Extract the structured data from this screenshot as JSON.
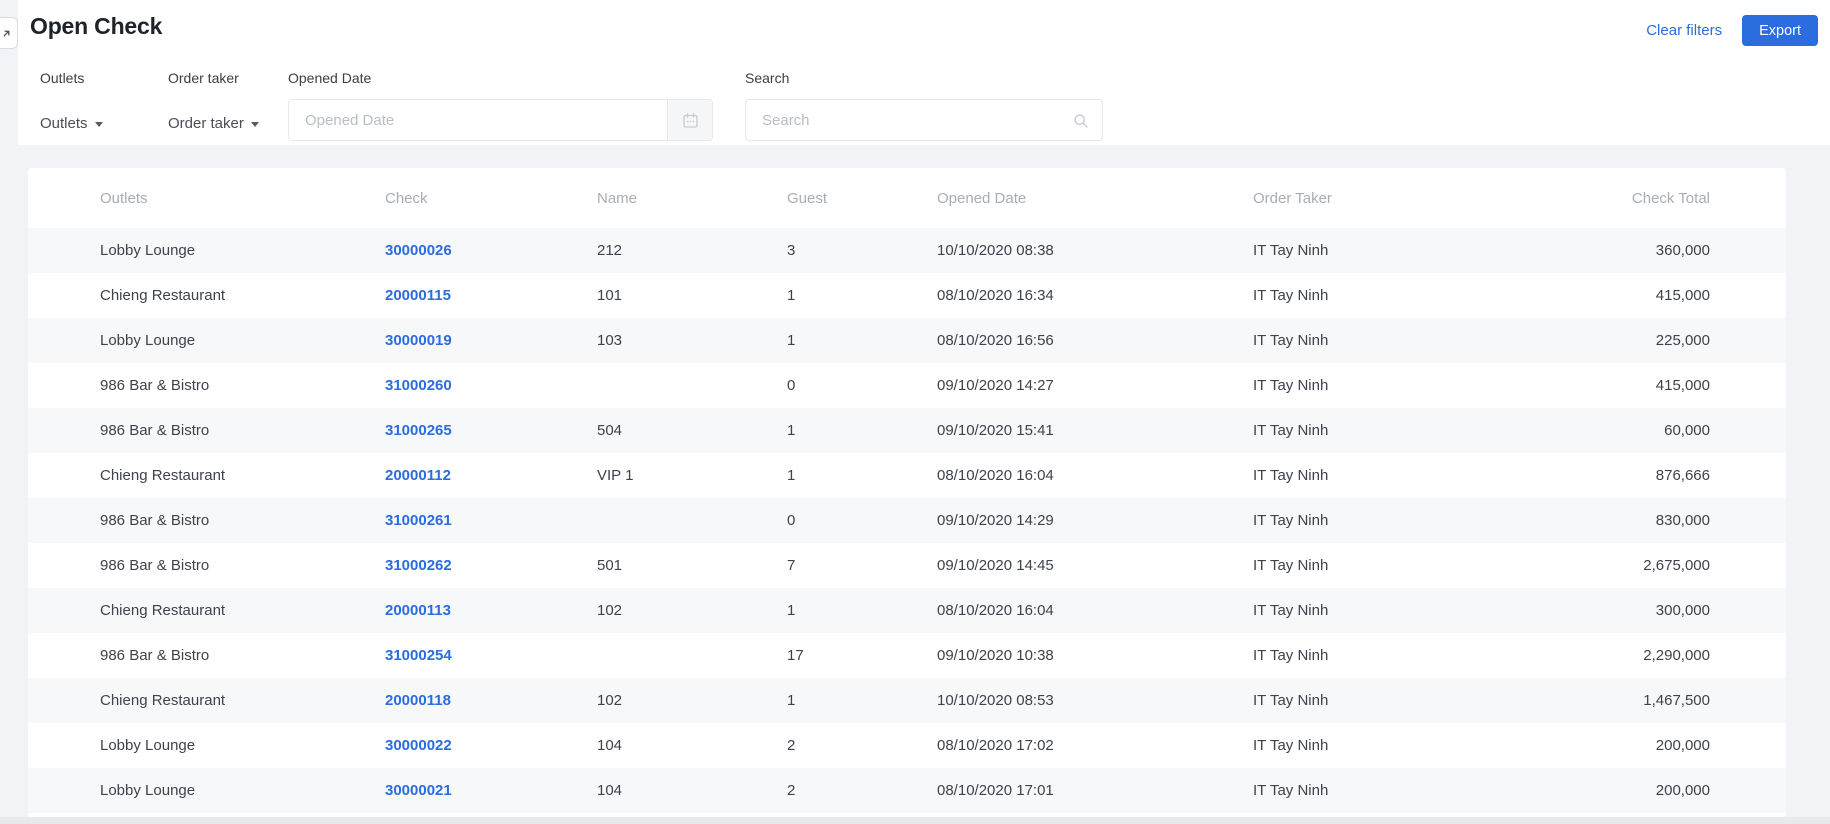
{
  "page": {
    "title": "Open Check",
    "clear_filters_label": "Clear filters",
    "export_label": "Export"
  },
  "filters": {
    "outlets": {
      "label": "Outlets",
      "value": "Outlets"
    },
    "order_taker": {
      "label": "Order taker",
      "value": "Order taker"
    },
    "opened_date": {
      "label": "Opened Date",
      "placeholder": "Opened Date",
      "icon": "calendar-icon"
    },
    "search": {
      "label": "Search",
      "placeholder": "Search",
      "icon": "search-icon"
    }
  },
  "table": {
    "columns": [
      "Outlets",
      "Check",
      "Name",
      "Guest",
      "Opened Date",
      "Order Taker",
      "Check Total"
    ],
    "rows": [
      {
        "outlet": "Lobby Lounge",
        "check": "30000026",
        "name": "212",
        "guest": "3",
        "opened_date": "10/10/2020 08:38",
        "order_taker": "IT Tay Ninh",
        "check_total": "360,000"
      },
      {
        "outlet": "Chieng Restaurant",
        "check": "20000115",
        "name": "101",
        "guest": "1",
        "opened_date": "08/10/2020 16:34",
        "order_taker": "IT Tay Ninh",
        "check_total": "415,000"
      },
      {
        "outlet": "Lobby Lounge",
        "check": "30000019",
        "name": "103",
        "guest": "1",
        "opened_date": "08/10/2020 16:56",
        "order_taker": "IT Tay Ninh",
        "check_total": "225,000"
      },
      {
        "outlet": "986 Bar & Bistro",
        "check": "31000260",
        "name": "",
        "guest": "0",
        "opened_date": "09/10/2020 14:27",
        "order_taker": "IT Tay Ninh",
        "check_total": "415,000"
      },
      {
        "outlet": "986 Bar & Bistro",
        "check": "31000265",
        "name": "504",
        "guest": "1",
        "opened_date": "09/10/2020 15:41",
        "order_taker": "IT Tay Ninh",
        "check_total": "60,000"
      },
      {
        "outlet": "Chieng Restaurant",
        "check": "20000112",
        "name": "VIP 1",
        "guest": "1",
        "opened_date": "08/10/2020 16:04",
        "order_taker": "IT Tay Ninh",
        "check_total": "876,666"
      },
      {
        "outlet": "986 Bar & Bistro",
        "check": "31000261",
        "name": "",
        "guest": "0",
        "opened_date": "09/10/2020 14:29",
        "order_taker": "IT Tay Ninh",
        "check_total": "830,000"
      },
      {
        "outlet": "986 Bar & Bistro",
        "check": "31000262",
        "name": "501",
        "guest": "7",
        "opened_date": "09/10/2020 14:45",
        "order_taker": "IT Tay Ninh",
        "check_total": "2,675,000"
      },
      {
        "outlet": "Chieng Restaurant",
        "check": "20000113",
        "name": "102",
        "guest": "1",
        "opened_date": "08/10/2020 16:04",
        "order_taker": "IT Tay Ninh",
        "check_total": "300,000"
      },
      {
        "outlet": "986 Bar & Bistro",
        "check": "31000254",
        "name": "",
        "guest": "17",
        "opened_date": "09/10/2020 10:38",
        "order_taker": "IT Tay Ninh",
        "check_total": "2,290,000"
      },
      {
        "outlet": "Chieng Restaurant",
        "check": "20000118",
        "name": "102",
        "guest": "1",
        "opened_date": "10/10/2020 08:53",
        "order_taker": "IT Tay Ninh",
        "check_total": "1,467,500"
      },
      {
        "outlet": "Lobby Lounge",
        "check": "30000022",
        "name": "104",
        "guest": "2",
        "opened_date": "08/10/2020 17:02",
        "order_taker": "IT Tay Ninh",
        "check_total": "200,000"
      },
      {
        "outlet": "Lobby Lounge",
        "check": "30000021",
        "name": "104",
        "guest": "2",
        "opened_date": "08/10/2020 17:01",
        "order_taker": "IT Tay Ninh",
        "check_total": "200,000"
      }
    ]
  },
  "colors": {
    "accent": "#2b6cdf",
    "row_alt_background": "#f7f8fa",
    "header_text": "#a8adb6",
    "cell_text": "#3d424c"
  }
}
